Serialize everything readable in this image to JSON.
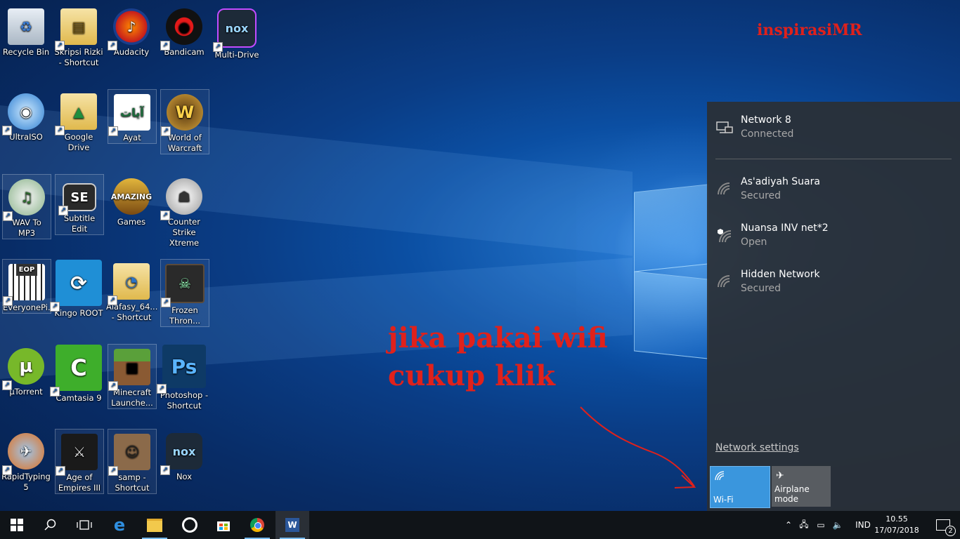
{
  "watermark": "inspirasiMR",
  "annotation": [
    "jika pakai wifi",
    "cukup klik"
  ],
  "desktop_icons": [
    {
      "label": "Recycle Bin",
      "icon": "recycle-bin-icon"
    },
    {
      "label": "Skripsi Rizki - Shortcut",
      "icon": "folder-icon"
    },
    {
      "label": "Audacity",
      "icon": "audacity-icon"
    },
    {
      "label": "Bandicam",
      "icon": "bandicam-icon"
    },
    {
      "label": "Multi-Drive",
      "icon": "nox-icon"
    },
    {
      "label": "UltraISO",
      "icon": "ultraiso-icon"
    },
    {
      "label": "Google Drive",
      "icon": "google-drive-icon"
    },
    {
      "label": "Ayat",
      "icon": "ayat-icon"
    },
    {
      "label": "World of Warcraft",
      "icon": "warcraft-icon"
    },
    {
      "label": "WAV To MP3",
      "icon": "cd-icon"
    },
    {
      "label": "Subtitle Edit",
      "icon": "subtitle-edit-icon"
    },
    {
      "label": "Games",
      "icon": "games-icon"
    },
    {
      "label": "Counter Strike Xtreme",
      "icon": "counter-strike-icon"
    },
    {
      "label": "EveryonePi...",
      "icon": "piano-icon"
    },
    {
      "label": "Kingo ROOT",
      "icon": "kingo-root-icon"
    },
    {
      "label": "Alafasy_64... - Shortcut",
      "icon": "folder-icon"
    },
    {
      "label": "Frozen Thron...",
      "icon": "frozen-throne-icon"
    },
    {
      "label": "µTorrent",
      "icon": "utorrent-icon"
    },
    {
      "label": "Camtasia 9",
      "icon": "camtasia-icon"
    },
    {
      "label": "Minecraft Launche...",
      "icon": "minecraft-icon"
    },
    {
      "label": "Photoshop - Shortcut",
      "icon": "photoshop-icon"
    },
    {
      "label": "RapidTyping 5",
      "icon": "rapidtyping-icon"
    },
    {
      "label": "Age of Empires III",
      "icon": "age-of-empires-icon"
    },
    {
      "label": "samp - Shortcut",
      "icon": "samp-icon"
    },
    {
      "label": "Nox",
      "icon": "nox-icon"
    }
  ],
  "network": {
    "connected": {
      "name": "Network  8",
      "status": "Connected"
    },
    "wifi_list": [
      {
        "name": "As'adiyah Suara",
        "status": "Secured"
      },
      {
        "name": "Nuansa INV net*2",
        "status": "Open"
      },
      {
        "name": "Hidden Network",
        "status": "Secured"
      }
    ],
    "settings_link": "Network settings",
    "tiles": [
      {
        "label": "Wi-Fi",
        "active": true
      },
      {
        "label": "Airplane mode",
        "active": false
      }
    ]
  },
  "taskbar": {
    "language": "IND",
    "time": "10.55",
    "date": "17/07/2018",
    "notification_count": "2"
  },
  "colors": {
    "accent": "#3a96dd",
    "annotation": "#e0211b"
  }
}
